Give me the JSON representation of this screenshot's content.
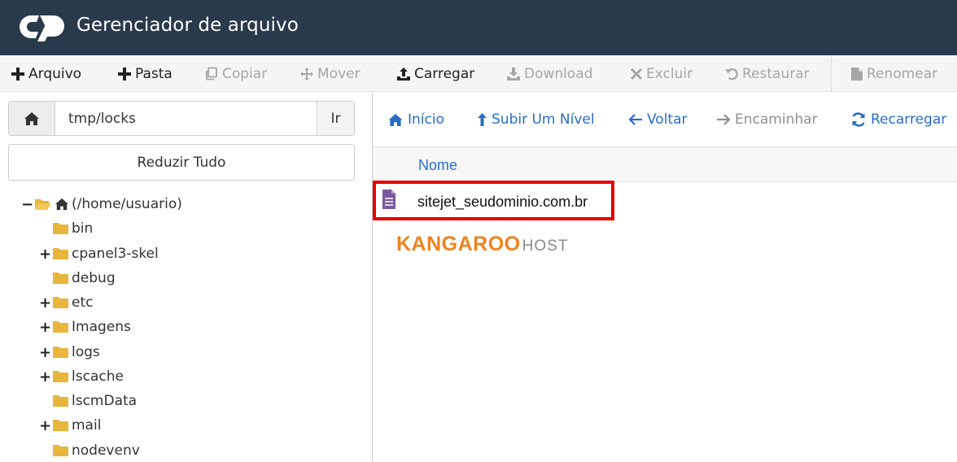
{
  "header": {
    "title": "Gerenciador de arquivo"
  },
  "toolbar": {
    "arquivo": "Arquivo",
    "pasta": "Pasta",
    "copiar": "Copiar",
    "mover": "Mover",
    "carregar": "Carregar",
    "download": "Download",
    "excluir": "Excluir",
    "restaurar": "Restaurar",
    "renomear": "Renomear"
  },
  "path": {
    "value": "tmp/locks",
    "go_label": "Ir"
  },
  "tree": {
    "collapse_label": "Reduzir Tudo",
    "root_label": "(/home/usuario)",
    "items": [
      {
        "label": "bin"
      },
      {
        "label": "cpanel3-skel"
      },
      {
        "label": "debug"
      },
      {
        "label": "etc"
      },
      {
        "label": "Imagens"
      },
      {
        "label": "logs"
      },
      {
        "label": "lscache"
      },
      {
        "label": "lscmData"
      },
      {
        "label": "mail"
      },
      {
        "label": "nodevenv"
      }
    ]
  },
  "nav": {
    "inicio": "Início",
    "subir": "Subir Um Nível",
    "voltar": "Voltar",
    "encaminhar": "Encaminhar",
    "recarregar": "Recarregar"
  },
  "list": {
    "columns": {
      "name": "Nome"
    },
    "files": [
      {
        "name": "sitejet_seudominio.com.br"
      }
    ]
  },
  "watermark": {
    "brand": "KANGAROO",
    "host": "HOST"
  },
  "colors": {
    "header_bg": "#293a4a",
    "link_blue": "#2a6cc4",
    "folder_yellow": "#e8b53d",
    "highlight_red": "#e50000",
    "brand_orange": "#f0821e"
  }
}
